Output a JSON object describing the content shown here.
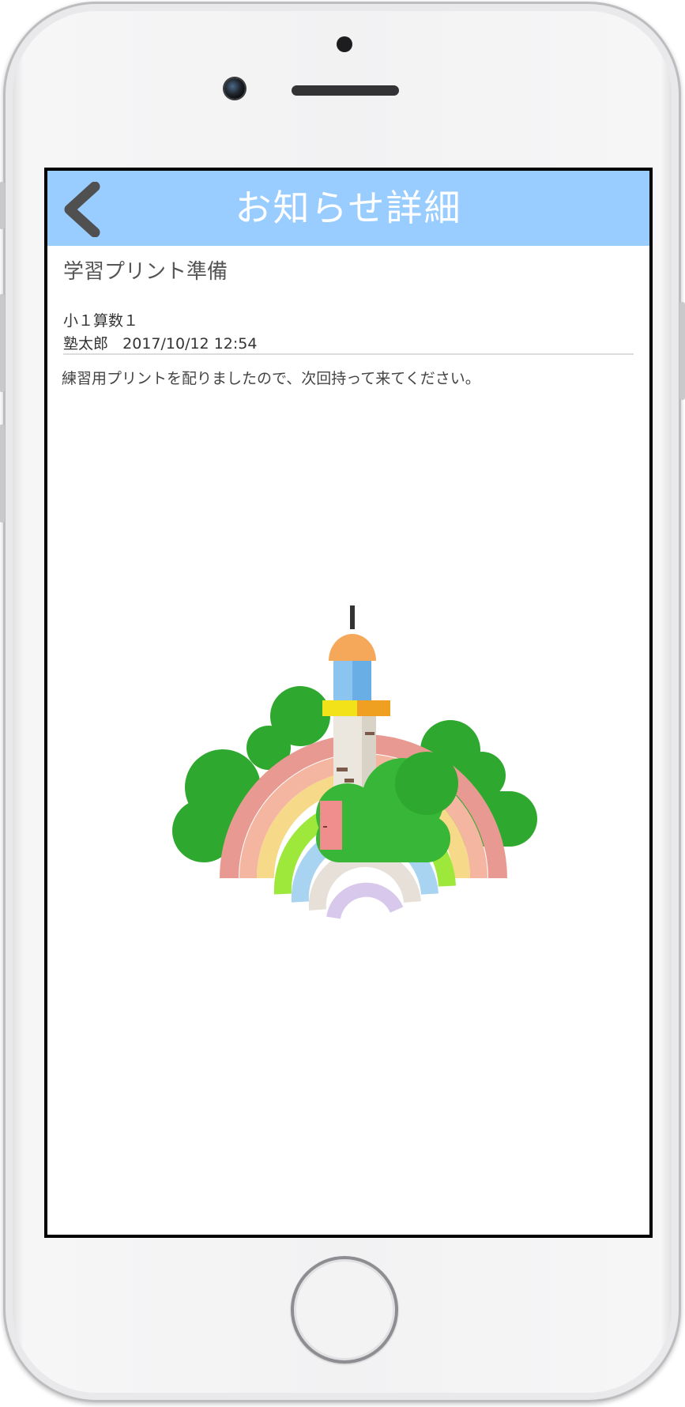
{
  "navbar": {
    "title": "お知らせ詳細",
    "back_icon": "chevron-left-icon",
    "bg_color": "#99ccff"
  },
  "notice": {
    "title": "学習プリント準備",
    "class_name": "小１算数１",
    "author": "塾太郎",
    "datetime": "2017/10/12 12:54",
    "body": "練習用プリントを配りましたので、次回持って来てください。"
  },
  "illustration": {
    "name": "lighthouse-rainbow-illustration"
  }
}
